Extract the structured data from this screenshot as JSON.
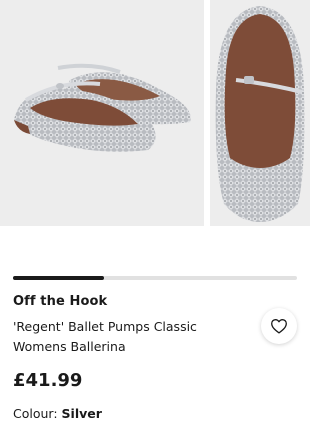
{
  "gallery": {
    "images": [
      {
        "icon": "silver-woven-ballet-pumps-pair-image"
      },
      {
        "icon": "silver-woven-ballet-pump-top-view-image"
      }
    ],
    "progress": 0.32
  },
  "product": {
    "brand": "Off the Hook",
    "name": "'Regent' Ballet Pumps Classic Womens Ballerina",
    "price": "£41.99",
    "colour_label": "Colour:",
    "colour_value": "Silver"
  },
  "wishlist": {
    "icon": "heart-outline-icon"
  },
  "colors": {
    "accent": "#1a1a1a",
    "image_bg": "#ededed",
    "track": "#e1e1e1"
  }
}
